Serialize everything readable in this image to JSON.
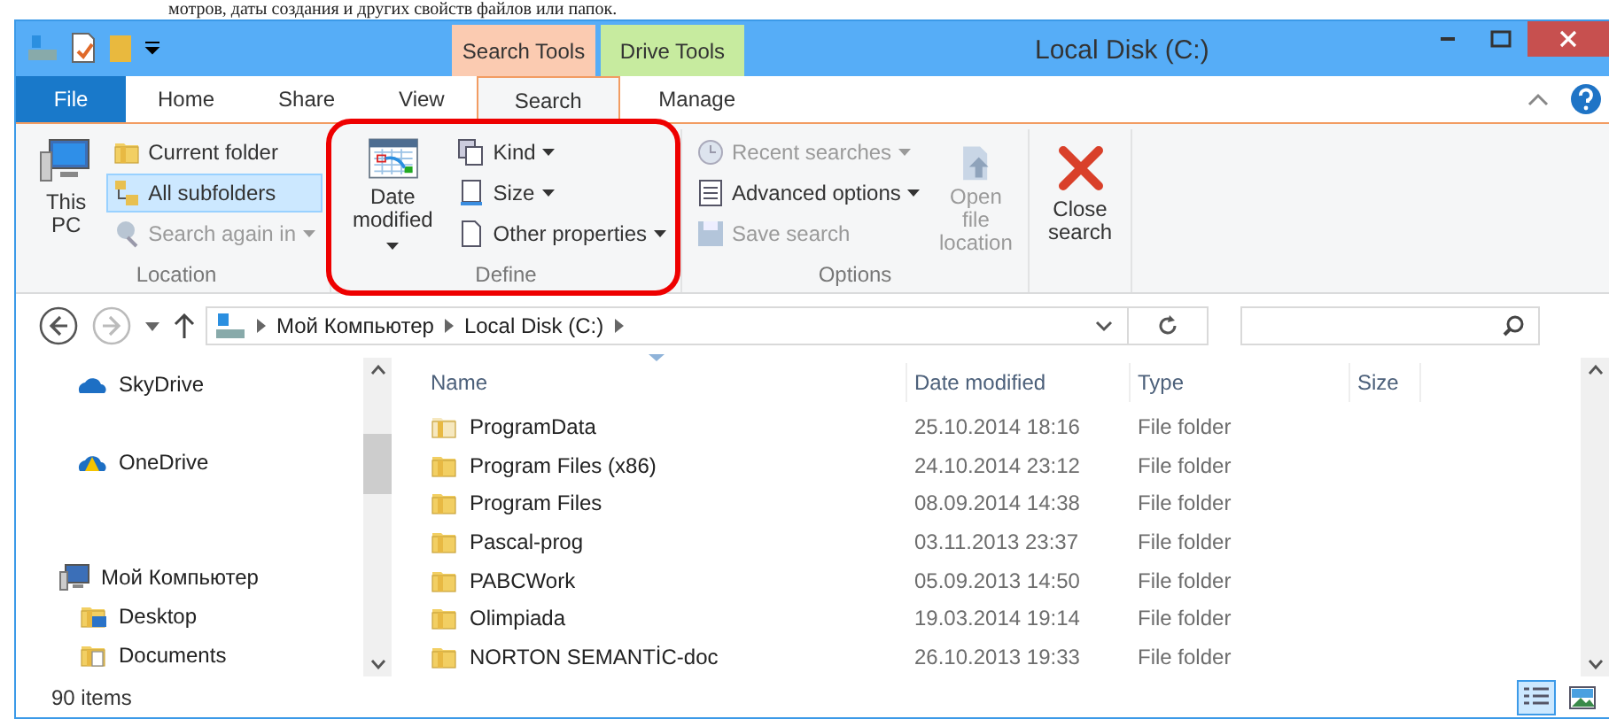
{
  "caption": {
    "text": "мотров, даты создания и других свойств файлов или папок."
  },
  "window": {
    "title": "Local Disk (C:)"
  },
  "context_tabs": [
    {
      "label": "Search Tools",
      "color": "#fbcbb1"
    },
    {
      "label": "Drive Tools",
      "color": "#c7eb9f"
    }
  ],
  "tabs": [
    {
      "label": "File",
      "kind": "file",
      "selected": false
    },
    {
      "label": "Home",
      "kind": "tab",
      "selected": false
    },
    {
      "label": "Share",
      "kind": "tab",
      "selected": false
    },
    {
      "label": "View",
      "kind": "tab",
      "selected": false
    },
    {
      "label": "Search",
      "kind": "tab",
      "selected": true
    },
    {
      "label": "Manage",
      "kind": "tab",
      "selected": false
    }
  ],
  "ribbon": {
    "groups": [
      {
        "label": "Location",
        "items": [
          {
            "kind": "big",
            "label": "This PC",
            "disabled": false,
            "dropdown": false
          },
          {
            "kind": "stack",
            "items": [
              {
                "label": "Current folder",
                "disabled": false,
                "selected": false,
                "dropdown": false
              },
              {
                "label": "All subfolders",
                "disabled": false,
                "selected": true,
                "dropdown": false
              },
              {
                "label": "Search again in",
                "disabled": true,
                "selected": false,
                "dropdown": true
              }
            ]
          }
        ]
      },
      {
        "label": "Define",
        "items": [
          {
            "kind": "big",
            "label": "Date modified",
            "disabled": false,
            "dropdown": true
          },
          {
            "kind": "stack",
            "items": [
              {
                "label": "Kind",
                "disabled": false,
                "selected": false,
                "dropdown": true
              },
              {
                "label": "Size",
                "disabled": false,
                "selected": false,
                "dropdown": true
              },
              {
                "label": "Other properties",
                "disabled": false,
                "selected": false,
                "dropdown": true
              }
            ]
          }
        ]
      },
      {
        "label": "Options",
        "items": [
          {
            "kind": "stack",
            "items": [
              {
                "label": "Recent searches",
                "disabled": true,
                "selected": false,
                "dropdown": true
              },
              {
                "label": "Advanced options",
                "disabled": false,
                "selected": false,
                "dropdown": true
              },
              {
                "label": "Save search",
                "disabled": true,
                "selected": false,
                "dropdown": false
              }
            ]
          },
          {
            "kind": "big",
            "label": "Open file location",
            "disabled": true,
            "dropdown": false
          }
        ]
      },
      {
        "items": [
          {
            "kind": "big",
            "label": "Close search",
            "disabled": false,
            "dropdown": false
          }
        ]
      }
    ]
  },
  "address": {
    "crumbs": [
      "Мой Компьютер",
      "Local Disk (C:)"
    ]
  },
  "sidebar": {
    "items": [
      {
        "label": "SkyDrive"
      },
      {
        "label": "OneDrive"
      },
      {
        "label": "Мой Компьютер",
        "children": [
          {
            "label": "Desktop"
          },
          {
            "label": "Documents"
          }
        ]
      }
    ]
  },
  "table": {
    "columns": [
      {
        "label": "Name",
        "sorted": true
      },
      {
        "label": "Date modified",
        "sorted": false
      },
      {
        "label": "Type",
        "sorted": false
      },
      {
        "label": "Size",
        "sorted": false
      }
    ],
    "rows": [
      {
        "name": "ProgramData",
        "date": "25.10.2014 18:16",
        "type": "File folder",
        "hidden": true
      },
      {
        "name": "Program Files (x86)",
        "date": "24.10.2014 23:12",
        "type": "File folder",
        "hidden": false
      },
      {
        "name": "Program Files",
        "date": "08.09.2014 14:38",
        "type": "File folder",
        "hidden": false
      },
      {
        "name": "Pascal-prog",
        "date": "03.11.2013 23:37",
        "type": "File folder",
        "hidden": false
      },
      {
        "name": "PABCWork",
        "date": "05.09.2013 14:50",
        "type": "File folder",
        "hidden": false
      },
      {
        "name": "Olimpiada",
        "date": "19.03.2014 19:14",
        "type": "File folder",
        "hidden": false
      },
      {
        "name": "NORTON SEMANTİC-doc",
        "date": "26.10.2013 19:33",
        "type": "File folder",
        "hidden": false
      }
    ]
  },
  "status_bar": {
    "text": "90 items",
    "views": [
      {
        "kind": "details",
        "selected": true
      },
      {
        "kind": "thumbnails",
        "selected": false
      }
    ]
  },
  "annotation": {
    "kind": "highlight",
    "color": "#ee0000"
  }
}
